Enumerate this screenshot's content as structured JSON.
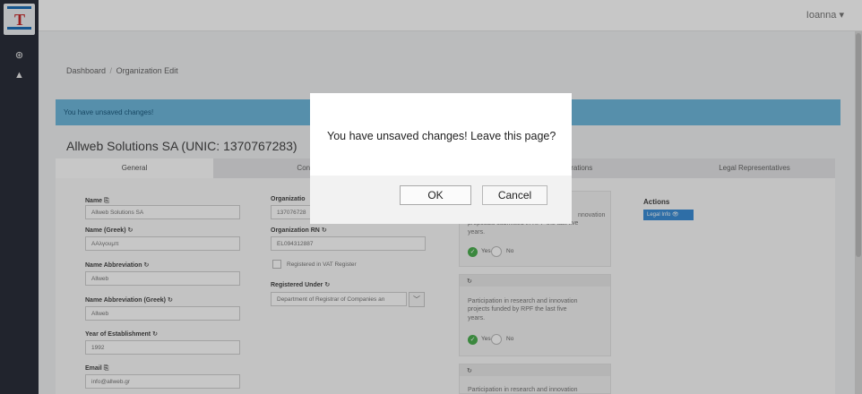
{
  "topbar": {
    "user": "Ioanna ▾"
  },
  "sidebar": {
    "items": [
      {
        "icon": "dashboard-icon",
        "glyph": "⊛"
      },
      {
        "icon": "user-icon",
        "glyph": "▲"
      }
    ]
  },
  "breadcrumb": {
    "home": "Dashboard",
    "separator": "/",
    "current": "Organization Edit"
  },
  "alert": {
    "text": "You have unsaved changes!"
  },
  "org": {
    "title": "Allweb Solutions SA (UNIC: 1370767283)"
  },
  "tabs": [
    {
      "label": "General"
    },
    {
      "label": "Contact Info"
    },
    {
      "label": "arations"
    },
    {
      "label": "Legal Representatives"
    }
  ],
  "form": {
    "name": {
      "label": "Name",
      "value": "Allweb Solutions SA"
    },
    "name_greek": {
      "label": "Name (Greek)",
      "value": "AAλγουμπ"
    },
    "name_abbr": {
      "label": "Name Abbreviation",
      "value": "Allweb"
    },
    "name_abbr_greek": {
      "label": "Name Abbreviation (Greek)",
      "value": "Allweb"
    },
    "year": {
      "label": "Year of Establishment",
      "value": "1992"
    },
    "email": {
      "label": "Email",
      "value": "info@allweb.gr"
    },
    "org_id": {
      "label": "Organizatio",
      "value": "137076728"
    },
    "org_rn": {
      "label": "Organization RN",
      "value": "EL094312887"
    },
    "vat": {
      "label": "Registered in VAT Register"
    },
    "registered_under": {
      "label": "Registered Under",
      "value": "Department of Registrar of Companies an"
    }
  },
  "declarations": {
    "card1": {
      "text_line1": "nnovation",
      "text_line2": "proposals submitted in RPF the last five",
      "text_line3": "years."
    },
    "card2": {
      "text_line1": "Participation in research and innovation",
      "text_line2": "projects funded by RPF the last five",
      "text_line3": "years."
    },
    "card3": {
      "text_line1": "Participation in research and innovation"
    },
    "toggle": {
      "yes": "Yes",
      "no": "No"
    },
    "info_glyph": "↻"
  },
  "actions": {
    "label": "Actions",
    "button": "Legal Info 👁"
  },
  "dialog": {
    "message": "You have unsaved changes! Leave this page?",
    "ok": "OK",
    "cancel": "Cancel"
  },
  "colors": {
    "alert_bg": "#6fb8dc",
    "sidebar_bg": "#2b2f3a",
    "legal_btn": "#3b8ed6",
    "toggle_yes": "#4caf50"
  }
}
